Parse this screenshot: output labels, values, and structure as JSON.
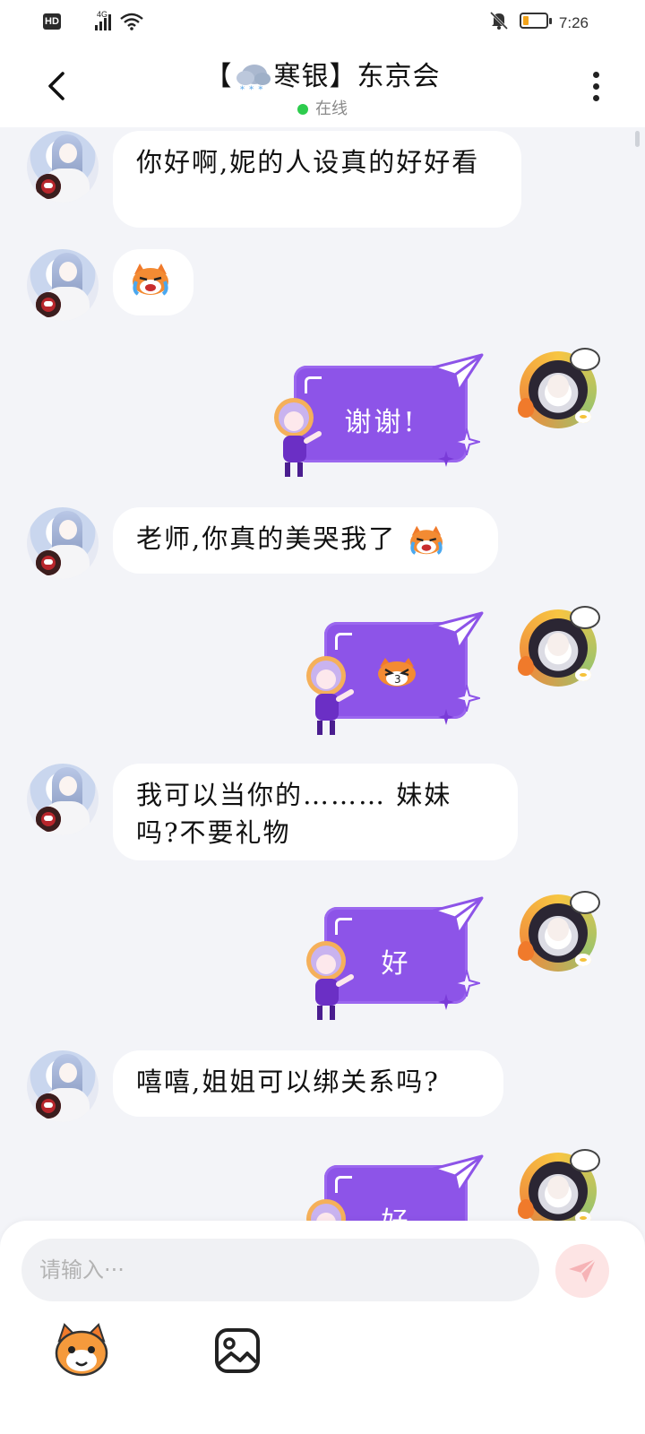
{
  "status_bar": {
    "hd": "HD",
    "network": "4G",
    "time": "7:26",
    "battery_level": 0.2,
    "battery_color": "#f2a31a",
    "icons": [
      "signal-icon",
      "wifi-icon",
      "mute-bell-icon",
      "battery-icon"
    ]
  },
  "header": {
    "title_left": "【",
    "title_right": "寒银】东京会",
    "title_icon": "snow-cloud-icon",
    "status": "在线",
    "status_color": "#2dcc4d"
  },
  "messages": [
    {
      "side": "left",
      "text": "你好啊,妮的人设真的好好看"
    },
    {
      "side": "left",
      "icon": "crying-cat-sticker"
    },
    {
      "side": "right",
      "card_text": "谢谢!"
    },
    {
      "side": "left",
      "text": "老师,你真的美哭我了",
      "icon": "crying-cat-sticker"
    },
    {
      "side": "right",
      "card_icon": "kiss-cat-sticker"
    },
    {
      "side": "left",
      "text": "我可以当你的……… 妹妹吗?不要礼物"
    },
    {
      "side": "right",
      "card_text": "好"
    },
    {
      "side": "left",
      "text": "嘻嘻,姐姐可以绑关系吗?"
    },
    {
      "side": "right",
      "card_text": "好"
    }
  ],
  "input": {
    "placeholder": "请输入···"
  },
  "colors": {
    "card_purple": "#8d54e8",
    "background": "#f3f4f8",
    "send_button_bg": "#fde4e4",
    "send_icon": "#f6b3b6"
  }
}
